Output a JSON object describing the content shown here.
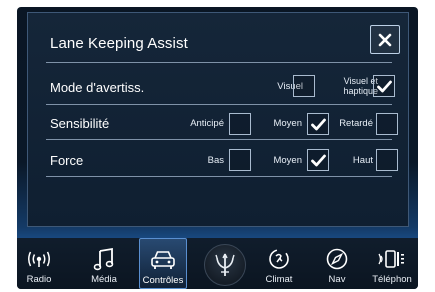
{
  "dialog": {
    "title": "Lane Keeping Assist",
    "close_icon": "close-icon"
  },
  "rows": [
    {
      "label": "Mode d'avertiss.",
      "options": [
        {
          "label": "Visuel",
          "checked": false
        },
        {
          "label_line1": "Visuel et",
          "label_line2": "haptique",
          "checked": true
        }
      ]
    },
    {
      "label": "Sensibilité",
      "options": [
        {
          "label": "Anticipé",
          "checked": false
        },
        {
          "label": "Moyen",
          "checked": true
        },
        {
          "label": "Retardé",
          "checked": false
        }
      ]
    },
    {
      "label": "Force",
      "options": [
        {
          "label": "Bas",
          "checked": false
        },
        {
          "label": "Moyen",
          "checked": true
        },
        {
          "label": "Haut",
          "checked": false
        }
      ]
    }
  ],
  "nav": [
    {
      "label": "Radio",
      "icon": "radio-icon",
      "active": false
    },
    {
      "label": "Média",
      "icon": "music-note-icon",
      "active": false
    },
    {
      "label": "Contrôles",
      "icon": "car-icon",
      "active": true
    },
    {
      "label": "",
      "icon": "trident-logo-icon",
      "active": false
    },
    {
      "label": "Climat",
      "icon": "climate-fan-icon",
      "active": false
    },
    {
      "label": "Nav",
      "icon": "compass-icon",
      "active": false
    },
    {
      "label": "Téléphon",
      "icon": "phone-icon",
      "active": false
    }
  ],
  "colors": {
    "accent": "#5a8fd0",
    "background": "#0a1624",
    "glow": "#1a4f8c"
  }
}
